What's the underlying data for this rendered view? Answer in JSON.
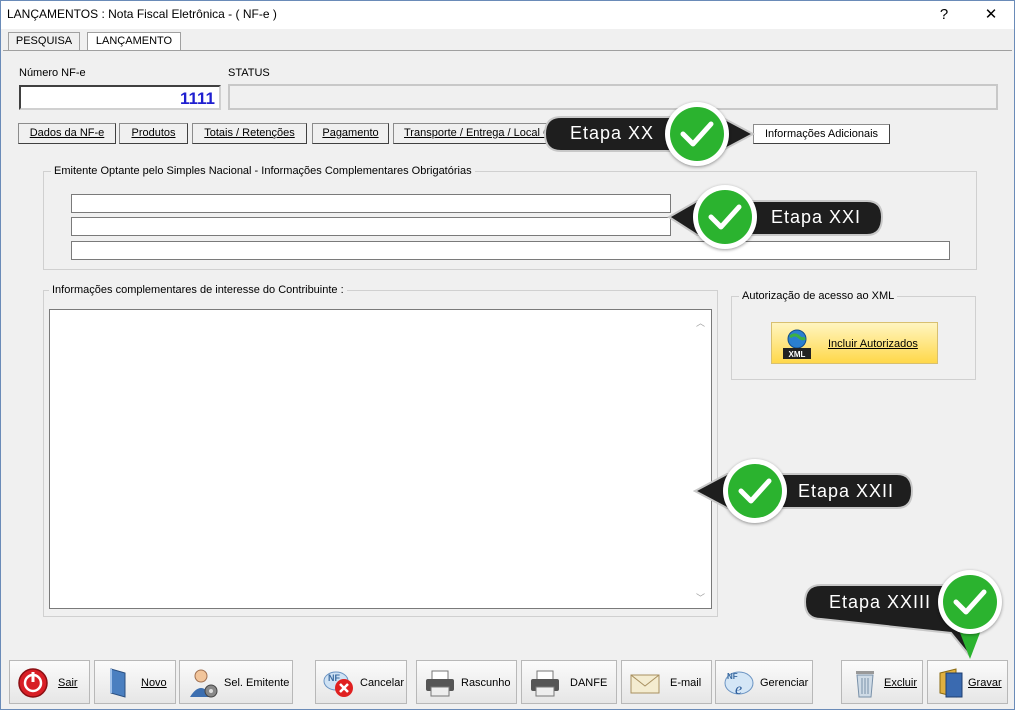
{
  "window": {
    "title": "LANÇAMENTOS : Nota Fiscal Eletrônica - ( NF-e )",
    "help_glyph": "?",
    "close_glyph": "✕"
  },
  "top_tabs": [
    {
      "label": "PESQUISA",
      "active": false
    },
    {
      "label": "LANÇAMENTO",
      "active": true
    }
  ],
  "header": {
    "nf_label": "Número NF-e",
    "nf_value": "1111",
    "status_label": "STATUS",
    "status_value": ""
  },
  "sub_tabs": [
    {
      "label": "Dados da NF-e"
    },
    {
      "label": "Produtos"
    },
    {
      "label": "Totais / Retenções"
    },
    {
      "label": "Pagamento"
    },
    {
      "label": "Transporte / Entrega / Local Cobrança"
    },
    {
      "label": "Informações Adicionais",
      "active": true
    }
  ],
  "simples_group": {
    "title": "Emitente Optante pelo Simples Nacional - Informações Complementares Obrigatórias",
    "lines": [
      "",
      "",
      ""
    ]
  },
  "contribuinte_group": {
    "title": "Informações complementares de interesse do Contribuinte :",
    "value": ""
  },
  "xml_group": {
    "title": "Autorização de acesso ao XML",
    "button_label": "Incluir Autorizados",
    "icon_caption": "XML"
  },
  "callouts": [
    {
      "label": "Etapa XX"
    },
    {
      "label": "Etapa XXI"
    },
    {
      "label": "Etapa XXII"
    },
    {
      "label": "Etapa XXIII"
    }
  ],
  "toolbar": [
    {
      "label": "Sair",
      "icon": "exit-icon"
    },
    {
      "label": "Novo",
      "icon": "new-document-icon"
    },
    {
      "label": "Sel. Emitente",
      "icon": "select-user-icon"
    },
    {
      "label": "Cancelar",
      "icon": "cancel-nfe-icon"
    },
    {
      "label": "Rascunho",
      "icon": "printer-icon"
    },
    {
      "label": "DANFE",
      "icon": "printer-icon"
    },
    {
      "label": "E-mail",
      "icon": "email-icon"
    },
    {
      "label": "Gerenciar",
      "icon": "manage-nfe-icon"
    },
    {
      "label": "Excluir",
      "icon": "recycle-bin-icon"
    },
    {
      "label": "Gravar",
      "icon": "save-icon"
    }
  ],
  "colors": {
    "nf_number": "#1f1fd0",
    "callout_bg": "#1e1e1e",
    "check_green": "#2bb32f",
    "xml_button": "#ffd84a"
  }
}
